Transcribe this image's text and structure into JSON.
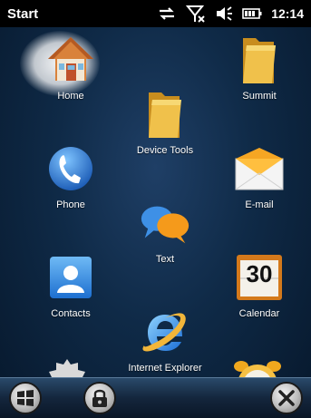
{
  "status_bar": {
    "title": "Start",
    "time": "12:14"
  },
  "tiles": [
    {
      "label": "Home",
      "icon": "home-icon"
    },
    {
      "label": "Summit",
      "icon": "folder-icon"
    },
    {
      "label": "Device Tools",
      "icon": "folder-icon"
    },
    {
      "label": "Phone",
      "icon": "phone-icon"
    },
    {
      "label": "E-mail",
      "icon": "email-icon"
    },
    {
      "label": "Text",
      "icon": "text-message-icon"
    },
    {
      "label": "Contacts",
      "icon": "contacts-icon"
    },
    {
      "label": "Calendar",
      "icon": "calendar-icon",
      "day": "30"
    },
    {
      "label": "Internet Explorer",
      "icon": "internet-explorer-icon"
    }
  ],
  "soft_keys": [
    "windows-start-button",
    "lock-button",
    "close-button"
  ],
  "colors": {
    "status_bar": "#000000",
    "background": "#0f2a47",
    "folder": "#e8b53e",
    "email": "#f5a623",
    "calendar_border": "#d4791b"
  }
}
